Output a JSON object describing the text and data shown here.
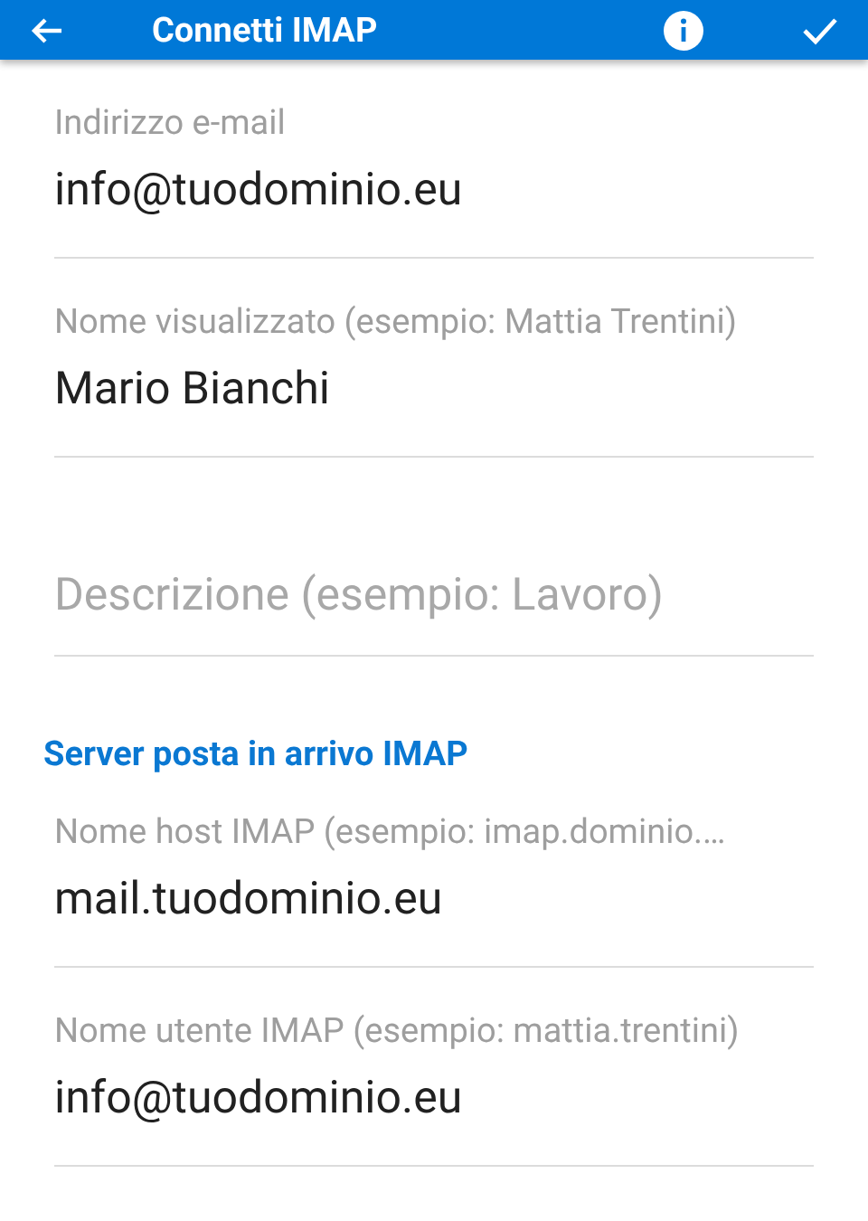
{
  "app_bar": {
    "title": "Connetti IMAP"
  },
  "fields": [
    {
      "label": "Indirizzo e-mail",
      "value": "info@tuodominio.eu"
    },
    {
      "label": "Nome visualizzato (esempio: Mattia Trentini)",
      "value": "Mario Bianchi"
    },
    {
      "placeholder": "Descrizione (esempio: Lavoro)"
    }
  ],
  "section": {
    "title": "Server posta in arrivo IMAP",
    "fields": [
      {
        "label": "Nome host IMAP (esempio: imap.dominio.…",
        "value": "mail.tuodominio.eu"
      },
      {
        "label": "Nome utente IMAP (esempio: mattia.trentini)",
        "value": "info@tuodominio.eu"
      }
    ]
  }
}
